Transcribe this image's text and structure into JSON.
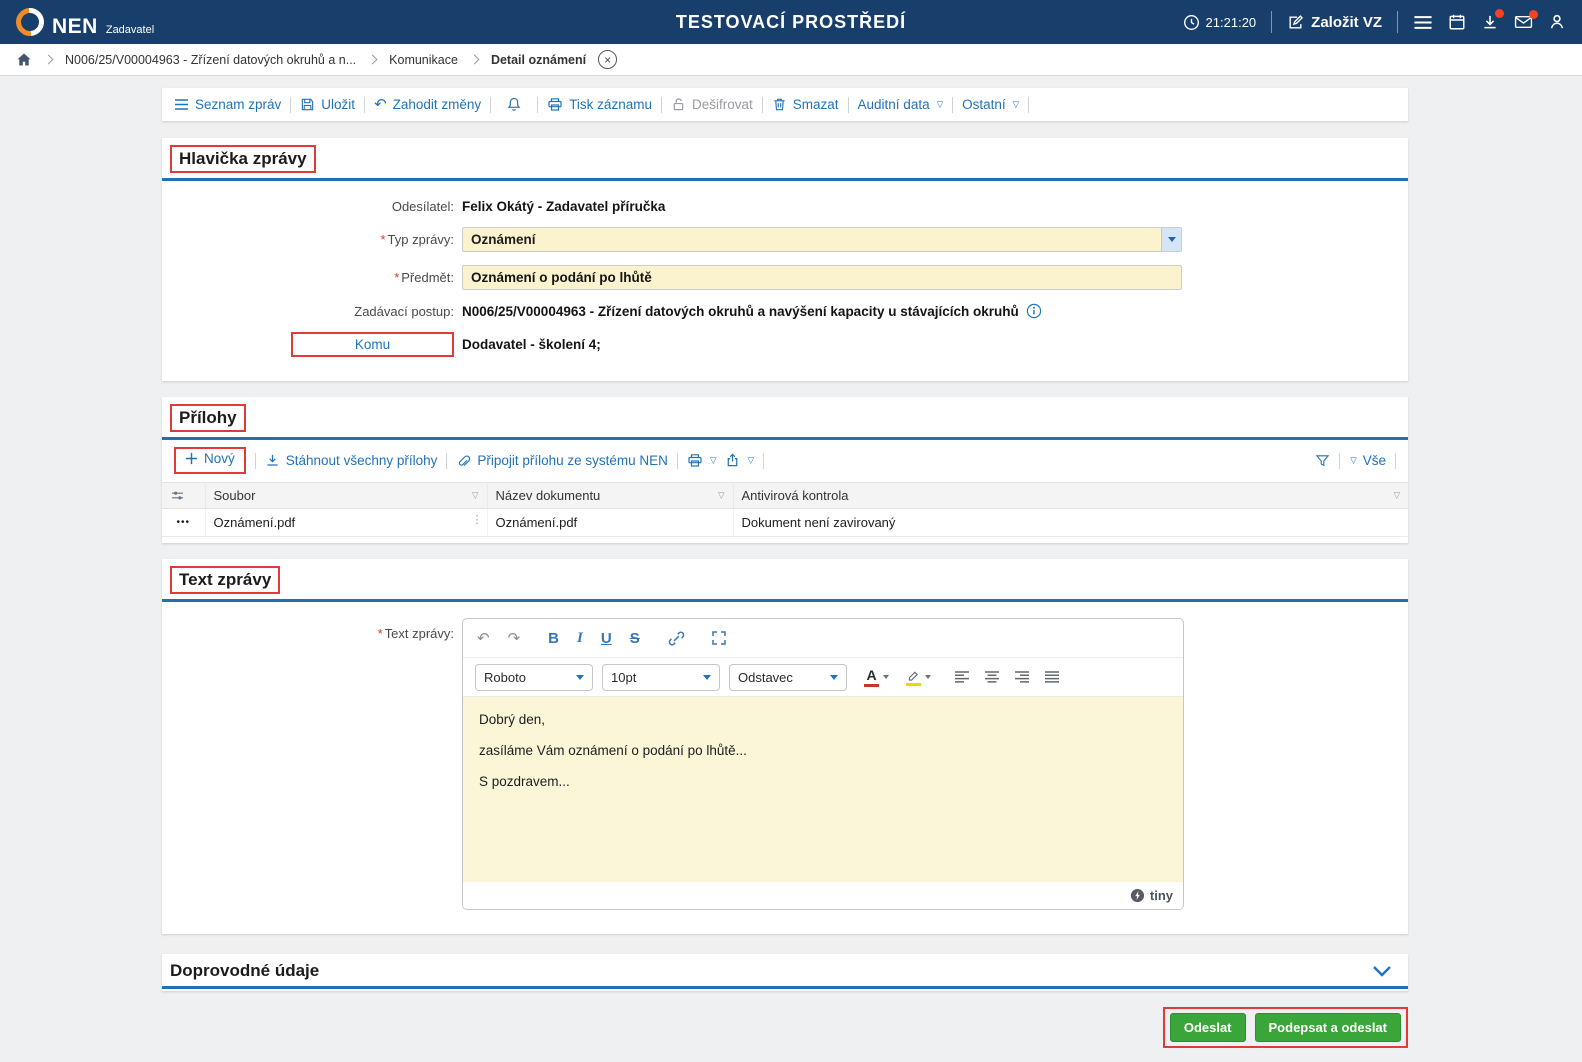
{
  "misc": {
    "required": "*"
  },
  "icons": {
    "dropdown": "▽",
    "close": "×",
    "dots": "•••",
    "cell_handle": "⋮",
    "undo": "↶",
    "redo": "↷",
    "bold": "B",
    "italic": "I",
    "underline": "U",
    "strike": "S",
    "color_letter": "A"
  },
  "header": {
    "brand": "NEN",
    "brand_sub": "Zadavatel",
    "title": "TESTOVACÍ PROSTŘEDÍ",
    "time": "21:21:20",
    "create_vz": "Založit VZ"
  },
  "breadcrumb": {
    "items": [
      {
        "label": "N006/25/V00004963 - Zřízení datových okruhů a n..."
      },
      {
        "label": "Komunikace"
      },
      {
        "label": "Detail oznámení"
      }
    ]
  },
  "toolbar": {
    "seznam": "Seznam zpráv",
    "ulozit": "Uložit",
    "zahodit": "Zahodit změny",
    "tisk": "Tisk záznamu",
    "desifrovat": "Dešifrovat",
    "smazat": "Smazat",
    "auditni": "Auditní data",
    "ostatni": "Ostatní"
  },
  "hlavicka": {
    "title": "Hlavička zprávy",
    "odesilatel_label": "Odesílatel:",
    "odesilatel_value": "Felix Okátý - Zadavatel příručka",
    "typ_label": "Typ zprávy:",
    "typ_value": "Oznámení",
    "predmet_label": "Předmět:",
    "predmet_value": "Oznámení o podání po lhůtě",
    "postup_label": "Zadávací postup:",
    "postup_value": "N006/25/V00004963 - Zřízení datových okruhů a navýšení kapacity u stávajících okruhů",
    "komu_label": "Komu",
    "komu_value": "Dodavatel - školení 4;"
  },
  "prilohy": {
    "title": "Přílohy",
    "novy": "Nový",
    "stahnout": "Stáhnout všechny přílohy",
    "pripojit": "Připojit přílohu ze systému NEN",
    "vse": "Vše",
    "columns": [
      "Soubor",
      "Název dokumentu",
      "Antivirová kontrola"
    ],
    "rows": [
      {
        "soubor": "Oznámení.pdf",
        "nazev": "Oznámení.pdf",
        "antivir": "Dokument není zavirovaný"
      }
    ]
  },
  "text_zpravy": {
    "title": "Text zprávy",
    "label": "Text zprávy:",
    "font": "Roboto",
    "size": "10pt",
    "block": "Odstavec",
    "paragraphs": [
      "Dobrý den,",
      "zasíláme Vám oznámení o podání po lhůtě...",
      "S pozdravem..."
    ],
    "brand": "tiny"
  },
  "doprovodne": {
    "title": "Doprovodné údaje"
  },
  "actions": {
    "odeslat": "Odeslat",
    "podepsat": "Podepsat a odeslat"
  },
  "colors": {
    "header_bg": "#183e6c",
    "accent_blue": "#2173b9",
    "rule_blue": "#1d71b8",
    "input_yellow": "#fbf3cd",
    "editor_yellow": "#fbf6d8",
    "button_green": "#3aa63a",
    "annotation_red": "#e23a3a"
  }
}
